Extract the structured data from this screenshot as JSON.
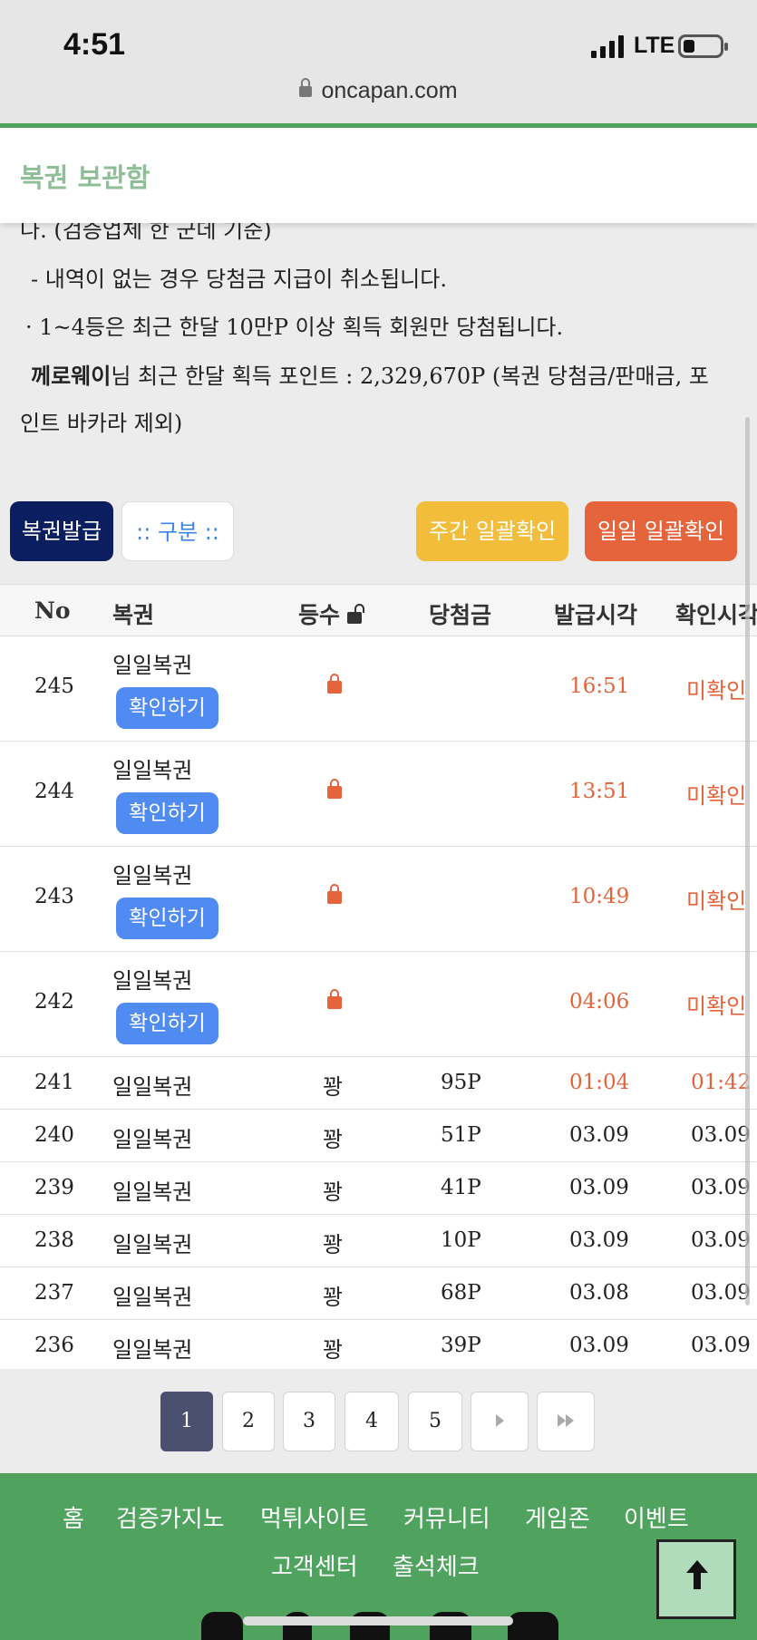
{
  "status": {
    "time": "4:51",
    "network": "LTE"
  },
  "browser": {
    "url": "oncapan.com"
  },
  "header": {
    "title": "복권 보관함"
  },
  "notice": {
    "line_partial": "나. (검증업체 한 군데 기준)",
    "line1": "- 내역이 없는 경우 당첨금 지급이 취소됩니다.",
    "line2": "· 1~4등은 최근 한달 10만P 이상 획득 회원만 당첨됩니다.",
    "line3_user": "께로웨이",
    "line3_rest": "님 최근 한달 획득 포인트 : 2,329,670P (복권 당첨금/판매금, 포",
    "line4": "인트 바카라 제외)"
  },
  "buttons": {
    "issue": "복권발급",
    "category": ":: 구분 ::",
    "weekly": "주간 일괄확인",
    "daily": "일일 일괄확인"
  },
  "table": {
    "headers": [
      "No",
      "복권",
      "등수",
      "당첨금",
      "발급시각",
      "확인시각"
    ],
    "locked_rows": [
      {
        "no": "245",
        "name": "일일복권",
        "action": "확인하기",
        "issued": "16:51",
        "checked": "미확인"
      },
      {
        "no": "244",
        "name": "일일복권",
        "action": "확인하기",
        "issued": "13:51",
        "checked": "미확인"
      },
      {
        "no": "243",
        "name": "일일복권",
        "action": "확인하기",
        "issued": "10:49",
        "checked": "미확인"
      },
      {
        "no": "242",
        "name": "일일복권",
        "action": "확인하기",
        "issued": "04:06",
        "checked": "미확인"
      }
    ],
    "rows": [
      {
        "no": "241",
        "name": "일일복권",
        "rank": "꽝",
        "prize": "95P",
        "issued": "01:04",
        "checked": "01:42"
      },
      {
        "no": "240",
        "name": "일일복권",
        "rank": "꽝",
        "prize": "51P",
        "issued": "03.09",
        "checked": "03.09"
      },
      {
        "no": "239",
        "name": "일일복권",
        "rank": "꽝",
        "prize": "41P",
        "issued": "03.09",
        "checked": "03.09"
      },
      {
        "no": "238",
        "name": "일일복권",
        "rank": "꽝",
        "prize": "10P",
        "issued": "03.09",
        "checked": "03.09"
      },
      {
        "no": "237",
        "name": "일일복권",
        "rank": "꽝",
        "prize": "68P",
        "issued": "03.08",
        "checked": "03.09"
      },
      {
        "no": "236",
        "name": "일일복권",
        "rank": "꽝",
        "prize": "39P",
        "issued": "03.09",
        "checked": "03.09"
      }
    ]
  },
  "pagination": {
    "pages": [
      "1",
      "2",
      "3",
      "4",
      "5"
    ],
    "current": "1"
  },
  "footer": {
    "nav1": [
      "홈",
      "검증카지노",
      "먹튀사이트",
      "커뮤니티",
      "게임존",
      "이벤트"
    ],
    "nav2": [
      "고객센터",
      "출석체크"
    ]
  },
  "colors": {
    "accent_green": "#4fa35e",
    "navy": "#0b1e5f",
    "orange": "#e5643b",
    "yellow": "#f3bd3c",
    "blue": "#4f8bf0"
  }
}
